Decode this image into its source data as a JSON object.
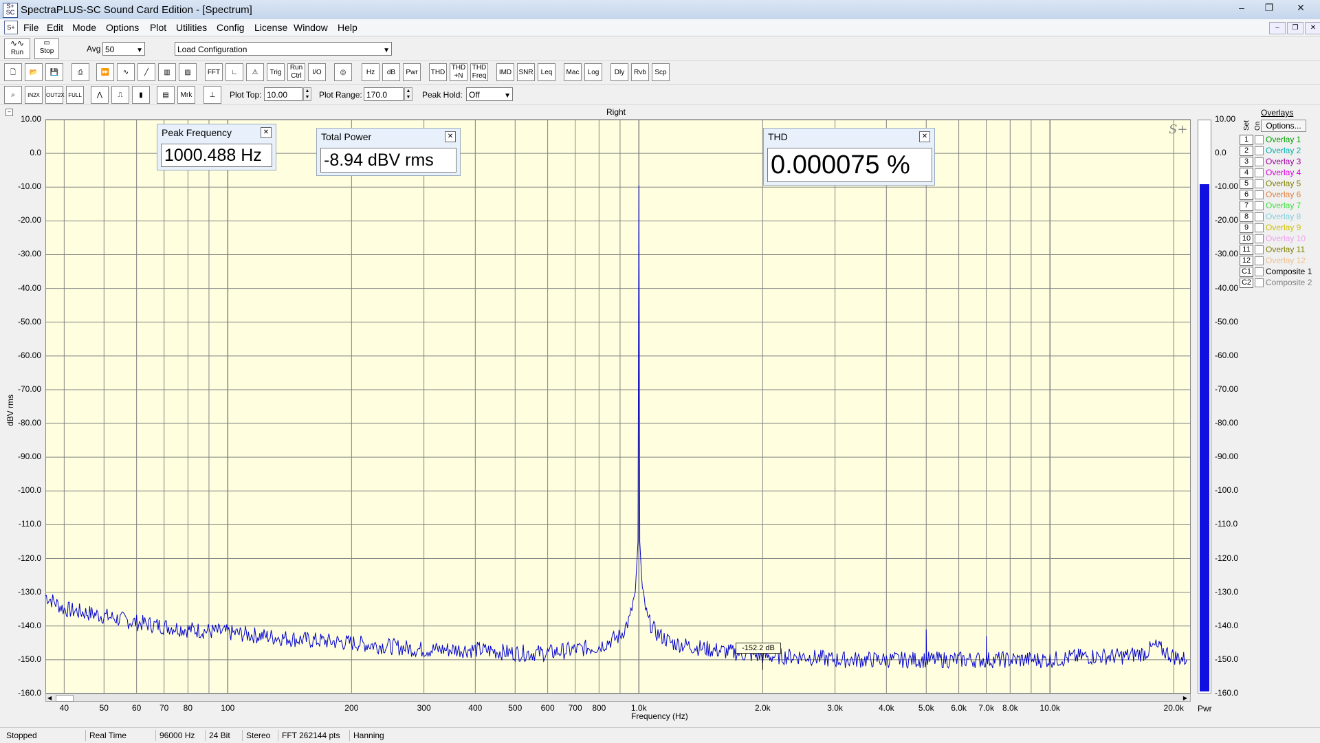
{
  "window": {
    "title": "SpectraPLUS-SC Sound Card Edition - [Spectrum]",
    "controls": [
      "–",
      "❐",
      "✕"
    ]
  },
  "menu": {
    "items": [
      "File",
      "Edit",
      "Mode",
      "Options",
      "Plot",
      "Utilities",
      "Config",
      "License",
      "Window",
      "Help"
    ]
  },
  "toolbar1": {
    "run_label": "Run",
    "stop_label": "Stop",
    "avg_label": "Avg",
    "avg_value": "50",
    "config_value": "Load Configuration"
  },
  "toolbar2": {
    "buttons": [
      "FFT",
      "Trig",
      "Run\nCtrl",
      "I/O",
      "Hz",
      "dB",
      "Pwr",
      "THD",
      "THD\n+N",
      "THD\nFreq",
      "IMD",
      "SNR",
      "Leq",
      "Mac",
      "Log",
      "Dly",
      "Rvb",
      "Scp"
    ]
  },
  "toolbar3": {
    "mrk_label": "Mrk",
    "plot_top_label": "Plot Top:",
    "plot_top_value": "10.00",
    "plot_range_label": "Plot Range:",
    "plot_range_value": "170.0",
    "peak_hold_label": "Peak Hold:",
    "peak_hold_value": "Off"
  },
  "plot": {
    "channel_title": "Right",
    "ylabel": "dBV rms",
    "xlabel": "Frequency (Hz)",
    "marker_label": "-152.2 dB",
    "logo": "S+"
  },
  "chart_data": {
    "type": "line",
    "title": "Right",
    "xlabel": "Frequency (Hz)",
    "ylabel": "dBV rms",
    "xscale": "log",
    "xlim": [
      36,
      22000
    ],
    "ylim": [
      -160,
      10
    ],
    "y_ticks": [
      "10.00",
      "0.0",
      "-10.00",
      "-20.00",
      "-30.00",
      "-40.00",
      "-50.00",
      "-60.00",
      "-70.00",
      "-80.00",
      "-90.00",
      "-100.0",
      "-110.0",
      "-120.0",
      "-130.0",
      "-140.0",
      "-150.0",
      "-160.0"
    ],
    "x_ticks": [
      {
        "v": 40,
        "t": "40"
      },
      {
        "v": 50,
        "t": "50"
      },
      {
        "v": 60,
        "t": "60"
      },
      {
        "v": 70,
        "t": "70"
      },
      {
        "v": 80,
        "t": "80"
      },
      {
        "v": 100,
        "t": "100"
      },
      {
        "v": 200,
        "t": "200"
      },
      {
        "v": 300,
        "t": "300"
      },
      {
        "v": 400,
        "t": "400"
      },
      {
        "v": 500,
        "t": "500"
      },
      {
        "v": 600,
        "t": "600"
      },
      {
        "v": 700,
        "t": "700"
      },
      {
        "v": 800,
        "t": "800"
      },
      {
        "v": 1000,
        "t": "1.0k"
      },
      {
        "v": 2000,
        "t": "2.0k"
      },
      {
        "v": 3000,
        "t": "3.0k"
      },
      {
        "v": 4000,
        "t": "4.0k"
      },
      {
        "v": 5000,
        "t": "5.0k"
      },
      {
        "v": 6000,
        "t": "6.0k"
      },
      {
        "v": 7000,
        "t": "7.0k"
      },
      {
        "v": 8000,
        "t": "8.0k"
      },
      {
        "v": 10000,
        "t": "10.0k"
      },
      {
        "v": 20000,
        "t": "20.0k"
      }
    ],
    "series": [
      {
        "color": "#0000cc",
        "x": [
          36,
          40,
          50,
          60,
          80,
          100,
          150,
          200,
          300,
          400,
          500,
          600,
          700,
          800,
          900,
          950,
          980,
          995,
          1000,
          1005,
          1020,
          1050,
          1100,
          1200,
          1500,
          2000,
          2500,
          3000,
          4000,
          5000,
          5000,
          5010,
          6000,
          7000,
          7000,
          7010,
          8000,
          10000,
          12000,
          15000,
          17000,
          18000,
          20000,
          21500
        ],
        "y": [
          -131,
          -135,
          -137,
          -139,
          -141,
          -142,
          -144,
          -145,
          -147,
          -147,
          -148,
          -148,
          -147,
          -146,
          -143,
          -138,
          -130,
          -115,
          -9.5,
          -115,
          -130,
          -138,
          -142,
          -145,
          -147,
          -149,
          -149,
          -150,
          -150,
          -150,
          -141,
          -150,
          -150,
          -150,
          -143,
          -150,
          -150,
          -150,
          -149,
          -149,
          -148,
          -146,
          -149,
          -150
        ]
      }
    ],
    "peak_frequency": "1000.488 Hz",
    "total_power": "-8.94 dBV rms",
    "thd": "0.000075 %",
    "grid": true
  },
  "meter": {
    "label": "Pwr",
    "level_db": -8.94,
    "ticks": [
      "10.00",
      "0.0",
      "-10.00",
      "-20.00",
      "-30.00",
      "-40.00",
      "-50.00",
      "-60.00",
      "-70.00",
      "-80.00",
      "-90.00",
      "-100.0",
      "-110.0",
      "-120.0",
      "-130.0",
      "-140.0",
      "-150.0",
      "-160.0"
    ],
    "fill_color": "#1010e0"
  },
  "info": {
    "peak_title": "Peak Frequency",
    "peak_value": "1000.488 Hz",
    "power_title": "Total Power",
    "power_value": "-8.94 dBV rms",
    "thd_title": "THD",
    "thd_value": "0.000075 %"
  },
  "overlays": {
    "title": "Overlays",
    "set_label": "Set",
    "on_label": "On",
    "options_label": "Options...",
    "items": [
      {
        "num": "1",
        "name": "Overlay 1",
        "color": "#00a000"
      },
      {
        "num": "2",
        "name": "Overlay 2",
        "color": "#00b0b0"
      },
      {
        "num": "3",
        "name": "Overlay 3",
        "color": "#a000a0"
      },
      {
        "num": "4",
        "name": "Overlay 4",
        "color": "#e000e0"
      },
      {
        "num": "5",
        "name": "Overlay 5",
        "color": "#808000"
      },
      {
        "num": "6",
        "name": "Overlay 6",
        "color": "#e08040"
      },
      {
        "num": "7",
        "name": "Overlay 7",
        "color": "#40e040"
      },
      {
        "num": "8",
        "name": "Overlay 8",
        "color": "#80d0e0"
      },
      {
        "num": "9",
        "name": "Overlay 9",
        "color": "#d0c000"
      },
      {
        "num": "10",
        "name": "Overlay 10",
        "color": "#f0a0f0"
      },
      {
        "num": "11",
        "name": "Overlay 11",
        "color": "#808000"
      },
      {
        "num": "12",
        "name": "Overlay 12",
        "color": "#f0c090"
      },
      {
        "num": "C1",
        "name": "Composite 1",
        "color": "#000000"
      },
      {
        "num": "C2",
        "name": "Composite 2",
        "color": "#808080"
      }
    ]
  },
  "status": {
    "fields": [
      "Stopped",
      "Real Time",
      "96000 Hz",
      "24 Bit",
      "Stereo",
      "FFT 262144 pts",
      "Hanning"
    ]
  }
}
